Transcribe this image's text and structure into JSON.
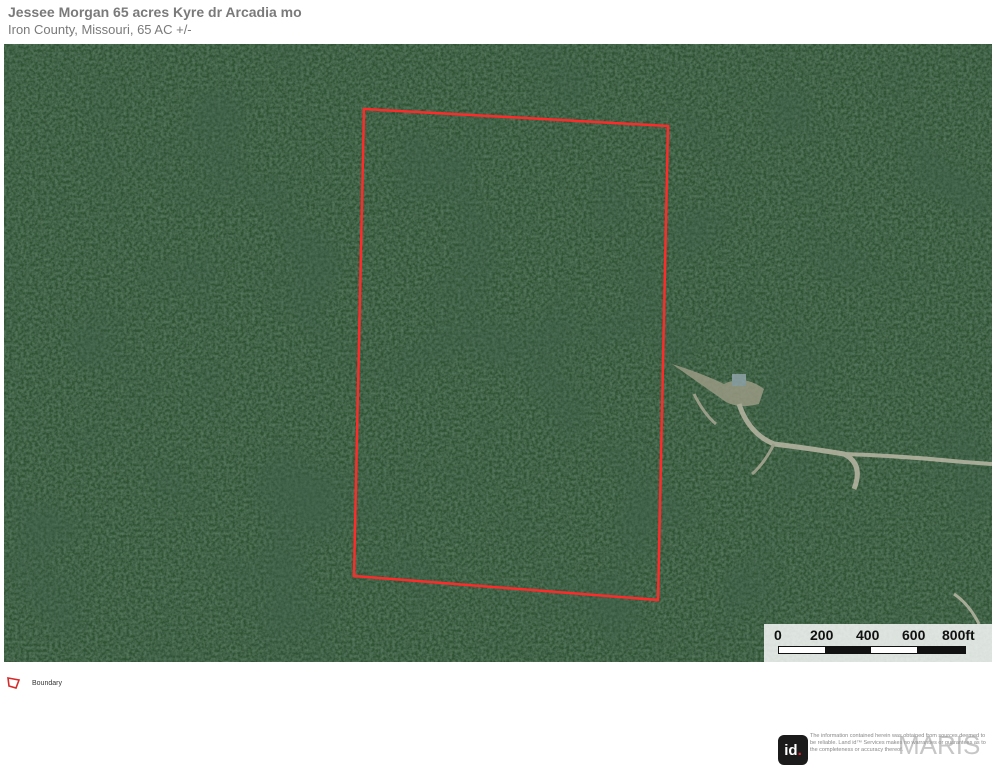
{
  "header": {
    "title": "Jessee Morgan 65 acres Kyre dr Arcadia mo",
    "subtitle": "Iron County, Missouri, 65 AC +/-"
  },
  "map": {
    "imagery": "satellite-forest",
    "boundary_color": "#ff2a2a",
    "scale": {
      "labels": [
        "0",
        "200",
        "400",
        "600",
        "800ft"
      ]
    }
  },
  "legend": {
    "items": [
      {
        "icon": "boundary-polygon-icon",
        "label": "Boundary",
        "color": "#d62b2b"
      }
    ]
  },
  "footer": {
    "logo_text": "id",
    "logo_dot": ".",
    "disclaimer": "The information contained herein was obtained from sources deemed to be reliable. Land id™ Services makes no warranties or guarantees as to the completeness or accuracy thereof.",
    "watermark": "MARIS"
  }
}
